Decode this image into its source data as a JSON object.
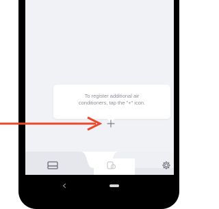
{
  "tooltip": {
    "text_line1": "To register additional air",
    "text_line2": "conditioners, tap the \"+\" icon."
  },
  "add_button": {
    "icon": "plus-icon"
  },
  "bottom_tabs": [
    {
      "icon": "air-conditioner-icon"
    },
    {
      "icon": "remote-control-icon"
    },
    {
      "icon": "gear-icon"
    }
  ],
  "nav": {
    "back_icon": "back-chevron-icon",
    "home_icon": "home-pill-icon"
  },
  "colors": {
    "screen_bg": "#f1f2f6",
    "tooltip_bg": "#ffffff",
    "annotation_arrow": "#e84a2b",
    "icon_gray": "#8a8d95"
  }
}
